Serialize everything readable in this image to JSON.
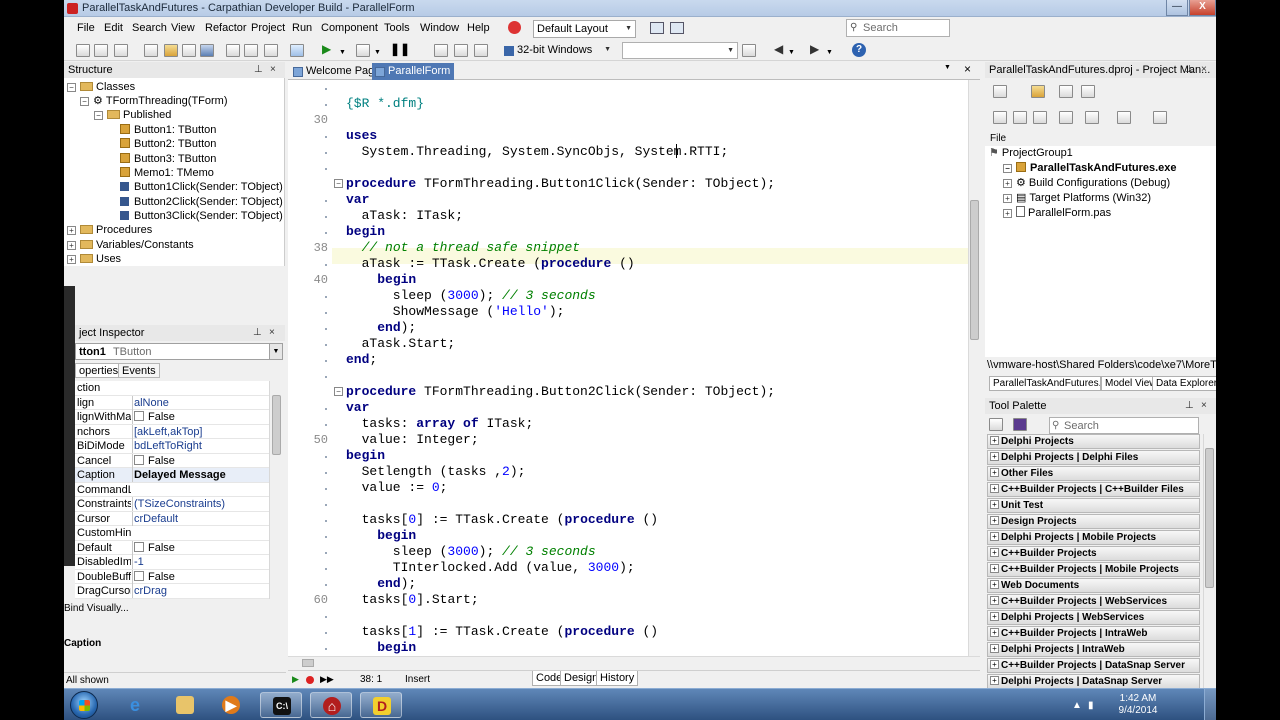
{
  "window": {
    "title": "ParallelTaskAndFutures - Carpathian Developer Build - ParallelForm",
    "minimize_label": "—",
    "close_label": "X"
  },
  "menu": {
    "items": [
      "File",
      "Edit",
      "Search",
      "View",
      "Refactor",
      "Project",
      "Run",
      "Component",
      "Tools",
      "Window",
      "Help"
    ],
    "layout_select": "Default Layout",
    "search_placeholder": "Search"
  },
  "toolbar": {
    "platform": "32-bit Windows"
  },
  "structure": {
    "title": "Structure",
    "tree": [
      {
        "label": "Classes",
        "type": "folder",
        "depth": 0
      },
      {
        "label": "TFormThreading(TForm)",
        "type": "class",
        "depth": 1
      },
      {
        "label": "Published",
        "type": "folder",
        "depth": 2
      },
      {
        "label": "Button1: TButton",
        "type": "member",
        "depth": 3
      },
      {
        "label": "Button2: TButton",
        "type": "member",
        "depth": 3
      },
      {
        "label": "Button3: TButton",
        "type": "member",
        "depth": 3
      },
      {
        "label": "Memo1: TMemo",
        "type": "member",
        "depth": 3
      },
      {
        "label": "Button1Click(Sender: TObject)",
        "type": "method",
        "depth": 3
      },
      {
        "label": "Button2Click(Sender: TObject)",
        "type": "method",
        "depth": 3
      },
      {
        "label": "Button3Click(Sender: TObject)",
        "type": "method",
        "depth": 3
      },
      {
        "label": "Procedures",
        "type": "folder",
        "depth": 0
      },
      {
        "label": "Variables/Constants",
        "type": "folder",
        "depth": 0
      },
      {
        "label": "Uses",
        "type": "folder",
        "depth": 0
      }
    ]
  },
  "object_inspector": {
    "title": "ject Inspector",
    "selected_object": "tton1",
    "selected_type": "TButton",
    "tabs": [
      "operties",
      "Events"
    ],
    "properties": [
      {
        "name": "ction",
        "value": "",
        "checkbox": false
      },
      {
        "name": "lign",
        "value": "alNone",
        "checkbox": false
      },
      {
        "name": "lignWithMa",
        "value": "False",
        "checkbox": true
      },
      {
        "name": "nchors",
        "value": "[akLeft,akTop]",
        "checkbox": false
      },
      {
        "name": "BiDiMode",
        "value": "bdLeftToRight",
        "checkbox": false
      },
      {
        "name": "Cancel",
        "value": "False",
        "checkbox": true
      },
      {
        "name": "Caption",
        "value": "Delayed Message",
        "checkbox": false,
        "selected": true
      },
      {
        "name": "CommandLi",
        "value": "",
        "checkbox": false
      },
      {
        "name": "Constraints",
        "value": "(TSizeConstraints)",
        "checkbox": false
      },
      {
        "name": "Cursor",
        "value": "crDefault",
        "checkbox": false
      },
      {
        "name": "CustomHint",
        "value": "",
        "checkbox": false
      },
      {
        "name": "Default",
        "value": "False",
        "checkbox": true
      },
      {
        "name": "DisabledIma",
        "value": "-1",
        "checkbox": false
      },
      {
        "name": "DoubleBuffe",
        "value": "False",
        "checkbox": true
      },
      {
        "name": "DragCursor",
        "value": "crDrag",
        "checkbox": false
      }
    ],
    "bind_visually": "Bind Visually...",
    "description_label": "Caption",
    "status": "All shown"
  },
  "editor": {
    "tabs": [
      "Welcome Page",
      "ParallelForm"
    ],
    "active_tab": "ParallelForm",
    "line_numbers": [
      {
        "n": "30",
        "row": 2
      },
      {
        "n": "38",
        "row": 10
      },
      {
        "n": "40",
        "row": 12
      },
      {
        "n": "50",
        "row": 22
      },
      {
        "n": "60",
        "row": 32
      }
    ],
    "status": {
      "position": "38:  1",
      "mode": "Insert",
      "views": [
        "Code",
        "Design",
        "History"
      ]
    }
  },
  "project_manager": {
    "title": "ParallelTaskAndFutures.dproj - Project Man...",
    "file_label": "File",
    "tree": [
      {
        "label": "ProjectGroup1",
        "depth": 0,
        "bold": false
      },
      {
        "label": "ParallelTaskAndFutures.exe",
        "depth": 1,
        "bold": true
      },
      {
        "label": "Build Configurations (Debug)",
        "depth": 2,
        "bold": false
      },
      {
        "label": "Target Platforms (Win32)",
        "depth": 2,
        "bold": false
      },
      {
        "label": "ParallelForm.pas",
        "depth": 2,
        "bold": false
      }
    ],
    "path": "\\\\vmware-host\\Shared Folders\\code\\xe7\\MoreThread",
    "tabs": [
      "ParallelTaskAndFutures....",
      "Model View",
      "Data Explorer"
    ]
  },
  "tool_palette": {
    "title": "Tool Palette",
    "search_placeholder": "Search",
    "categories": [
      "Delphi Projects",
      "Delphi Projects | Delphi Files",
      "Other Files",
      "C++Builder Projects | C++Builder Files",
      "Unit Test",
      "Design Projects",
      "Delphi Projects | Mobile Projects",
      "C++Builder Projects",
      "C++Builder Projects | Mobile Projects",
      "Web Documents",
      "C++Builder Projects | WebServices",
      "Delphi Projects | WebServices",
      "C++Builder Projects | IntraWeb",
      "Delphi Projects | IntraWeb",
      "C++Builder Projects | DataSnap Server",
      "Delphi Projects | DataSnap Server"
    ]
  },
  "taskbar": {
    "time": "1:42 AM",
    "date": "9/4/2014"
  }
}
